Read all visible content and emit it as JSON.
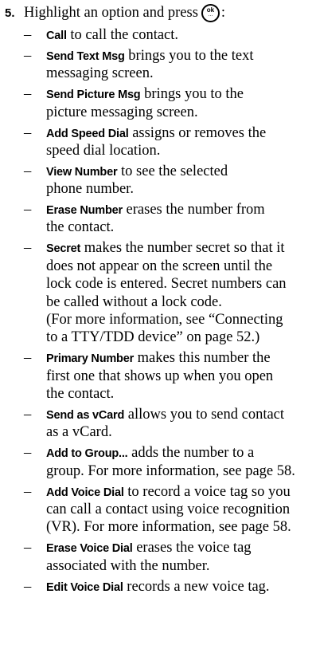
{
  "step": {
    "number": "5.",
    "text": "Highlight an option and press",
    "icon": "ok-button-icon",
    "icon_label": "ok",
    "trailing": ":"
  },
  "items": [
    {
      "term": "Call",
      "lines": [
        "to call the contact."
      ]
    },
    {
      "term": "Send Text Msg",
      "lines": [
        "brings you to the text",
        "messaging screen."
      ]
    },
    {
      "term": "Send Picture Msg",
      "lines": [
        "brings you to the",
        "picture messaging screen."
      ]
    },
    {
      "term": "Add Speed Dial",
      "lines": [
        "assigns or removes the",
        "speed dial location."
      ]
    },
    {
      "term": "View Number",
      "lines": [
        "to see the selected",
        "phone number."
      ]
    },
    {
      "term": "Erase Number",
      "lines": [
        "erases the number from",
        "the contact."
      ]
    },
    {
      "term": "Secret",
      "lines": [
        "makes the number secret so that it",
        "does not appear on the screen until the",
        "lock code is entered. Secret numbers can",
        "be called without a lock code.",
        "(For more information, see “Connecting",
        "to a TTY/TDD device” on page 52.)"
      ]
    },
    {
      "term": "Primary Number",
      "lines": [
        "makes this number the",
        "first one that shows up when you open",
        "the contact."
      ]
    },
    {
      "term": "Send as vCard",
      "lines": [
        "allows you to send contact",
        "as a vCard."
      ]
    },
    {
      "term": "Add to Group...",
      "lines": [
        "adds the number to a",
        "group. For more information, see page 58."
      ]
    },
    {
      "term": "Add Voice Dial",
      "lines": [
        "to record a voice tag so you",
        "can call a contact using voice recognition",
        "(VR). For more information, see page 58."
      ]
    },
    {
      "term": "Erase Voice Dial",
      "lines": [
        "erases the voice tag",
        "associated with the number."
      ]
    },
    {
      "term": "Edit Voice Dial",
      "lines": [
        "records a new voice tag."
      ]
    }
  ]
}
